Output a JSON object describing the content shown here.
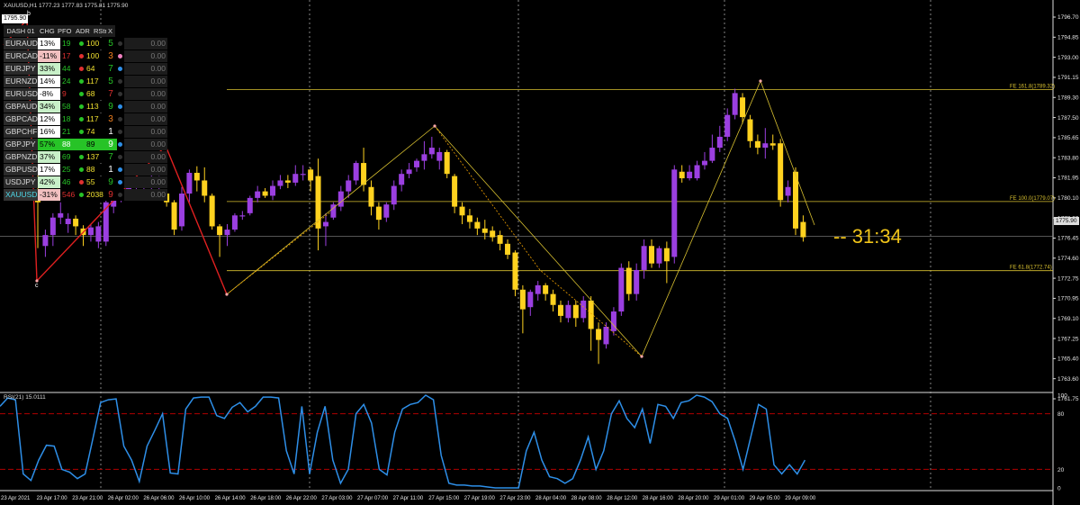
{
  "chart": {
    "title": "XAUUSD,H1  1777.23 1777.83 1775.81 1775.90",
    "price_box": "1795.90",
    "current_price": "1775.90",
    "timer": "-- 31:34",
    "rsi_label": "RSI(21) 15.0111",
    "point_labels": {
      "b": "b",
      "c": "c"
    }
  },
  "price_axis": [
    "1796.70",
    "1794.85",
    "1793.00",
    "1791.15",
    "1789.30",
    "1787.50",
    "1785.65",
    "1783.80",
    "1781.95",
    "1780.10",
    "1778.30",
    "1776.45",
    "1774.60",
    "1772.75",
    "1770.95",
    "1769.10",
    "1767.25",
    "1765.40",
    "1763.60",
    "1761.75"
  ],
  "rsi_axis": [
    "100",
    "80",
    "20",
    "0"
  ],
  "time_axis": [
    "23 Apr 2021",
    "23 Apr 17:00",
    "23 Apr 21:00",
    "26 Apr 02:00",
    "26 Apr 06:00",
    "26 Apr 10:00",
    "26 Apr 14:00",
    "26 Apr 18:00",
    "26 Apr 22:00",
    "27 Apr 03:00",
    "27 Apr 07:00",
    "27 Apr 11:00",
    "27 Apr 15:00",
    "27 Apr 19:00",
    "27 Apr 23:00",
    "28 Apr 04:00",
    "28 Apr 08:00",
    "28 Apr 12:00",
    "28 Apr 16:00",
    "28 Apr 20:00",
    "29 Apr 01:00",
    "29 Apr 05:00",
    "29 Apr 09:00"
  ],
  "fib_levels": [
    {
      "label": "FE 161.8(1789.32)",
      "price": 1789.32
    },
    {
      "label": "FE 100.0(1779.07)",
      "price": 1779.07
    },
    {
      "label": "FE 61.8(1772.74)",
      "price": 1772.74
    }
  ],
  "colors": {
    "bull": "#9b3fe0",
    "bear": "#ffd21f",
    "zigzag": "#e02020",
    "fib": "#d8c030",
    "rsi": "#2e8fe8",
    "rsi_level": "#b00000",
    "timer": "#f0c419"
  },
  "dashboard": {
    "title": "DASH 01",
    "headers": [
      "CHG",
      "PFO",
      "ADR",
      "RStr",
      "X"
    ],
    "rows": [
      {
        "sym": "EURAUD",
        "chg": "13%",
        "pfo": "19",
        "adr": "100",
        "rs": "5",
        "val": "0.00",
        "chg_bg": "#ffffff",
        "chg_fg": "#000",
        "pfo_bg": "#000",
        "pfo_fg": "#27c327",
        "dot": "#27c327",
        "adr_fg": "#f0e030",
        "rs_fg": "#27c327",
        "x": "#333",
        "sym_bg": "#2a2a2a",
        "sym_fg": "#ddd"
      },
      {
        "sym": "EURCAD",
        "chg": "-11%",
        "pfo": "17",
        "adr": "100",
        "rs": "3",
        "val": "0.00",
        "chg_bg": "#f2c0c0",
        "chg_fg": "#000",
        "pfo_bg": "#000",
        "pfo_fg": "#e03030",
        "dot": "#e03030",
        "adr_fg": "#f0e030",
        "rs_fg": "#f08020",
        "x": "#f080c0",
        "sym_bg": "#2a2a2a",
        "sym_fg": "#ddd"
      },
      {
        "sym": "EURJPY",
        "chg": "33%",
        "pfo": "44",
        "adr": "64",
        "rs": "7",
        "val": "0.00",
        "chg_bg": "#c8f0c8",
        "chg_fg": "#000",
        "pfo_bg": "#000",
        "pfo_fg": "#27c327",
        "dot": "#e03030",
        "adr_fg": "#f0e030",
        "rs_fg": "#27c327",
        "x": "#2e8fe8",
        "sym_bg": "#2a2a2a",
        "sym_fg": "#ddd"
      },
      {
        "sym": "EURNZD",
        "chg": "14%",
        "pfo": "24",
        "adr": "117",
        "rs": "5",
        "val": "0.00",
        "chg_bg": "#ffffff",
        "chg_fg": "#000",
        "pfo_bg": "#000",
        "pfo_fg": "#27c327",
        "dot": "#27c327",
        "adr_fg": "#f0e030",
        "rs_fg": "#27c327",
        "x": "#333",
        "sym_bg": "#2a2a2a",
        "sym_fg": "#ddd"
      },
      {
        "sym": "EURUSD",
        "chg": "-8%",
        "pfo": "9",
        "adr": "68",
        "rs": "7",
        "val": "0.00",
        "chg_bg": "#ffffff",
        "chg_fg": "#000",
        "pfo_bg": "#000",
        "pfo_fg": "#e03030",
        "dot": "#27c327",
        "adr_fg": "#f0e030",
        "rs_fg": "#e03030",
        "x": "#333",
        "sym_bg": "#2a2a2a",
        "sym_fg": "#ddd"
      },
      {
        "sym": "GBPAUD",
        "chg": "34%",
        "pfo": "58",
        "adr": "113",
        "rs": "9",
        "val": "0.00",
        "chg_bg": "#c8f0c8",
        "chg_fg": "#000",
        "pfo_bg": "#000",
        "pfo_fg": "#27c327",
        "dot": "#27c327",
        "adr_fg": "#f0e030",
        "rs_fg": "#27c327",
        "x": "#2e8fe8",
        "sym_bg": "#2a2a2a",
        "sym_fg": "#ddd"
      },
      {
        "sym": "GBPCAD",
        "chg": "12%",
        "pfo": "18",
        "adr": "117",
        "rs": "3",
        "val": "0.00",
        "chg_bg": "#ffffff",
        "chg_fg": "#000",
        "pfo_bg": "#000",
        "pfo_fg": "#27c327",
        "dot": "#27c327",
        "adr_fg": "#f0e030",
        "rs_fg": "#f08020",
        "x": "#333",
        "sym_bg": "#2a2a2a",
        "sym_fg": "#ddd"
      },
      {
        "sym": "GBPCHF",
        "chg": "16%",
        "pfo": "21",
        "adr": "74",
        "rs": "1",
        "val": "0.00",
        "chg_bg": "#ffffff",
        "chg_fg": "#000",
        "pfo_bg": "#000",
        "pfo_fg": "#27c327",
        "dot": "#27c327",
        "adr_fg": "#f0e030",
        "rs_fg": "#ffffff",
        "x": "#333",
        "sym_bg": "#2a2a2a",
        "sym_fg": "#ddd"
      },
      {
        "sym": "GBPJPY",
        "chg": "57%",
        "pfo": "88",
        "adr": "89",
        "rs": "9",
        "val": "0.00",
        "chg_bg": "#27c327",
        "chg_fg": "#000",
        "pfo_bg": "#27c327",
        "pfo_fg": "#fff",
        "dot": "#27c327",
        "adr_fg": "#000",
        "adr_bg": "#27c327",
        "rs_fg": "#ffffff",
        "rs_bg": "#27c327",
        "x": "#2e8fe8",
        "sym_bg": "#2a2a2a",
        "sym_fg": "#ddd"
      },
      {
        "sym": "GBPNZD",
        "chg": "37%",
        "pfo": "69",
        "adr": "137",
        "rs": "7",
        "val": "0.00",
        "chg_bg": "#c8f0c8",
        "chg_fg": "#000",
        "pfo_bg": "#000",
        "pfo_fg": "#27c327",
        "dot": "#27c327",
        "adr_fg": "#f0e030",
        "rs_fg": "#27c327",
        "x": "#333",
        "sym_bg": "#2a2a2a",
        "sym_fg": "#ddd"
      },
      {
        "sym": "GBPUSD",
        "chg": "17%",
        "pfo": "25",
        "adr": "88",
        "rs": "1",
        "val": "0.00",
        "chg_bg": "#ffffff",
        "chg_fg": "#000",
        "pfo_bg": "#000",
        "pfo_fg": "#27c327",
        "dot": "#27c327",
        "adr_fg": "#f0e030",
        "rs_fg": "#ffffff",
        "x": "#2e8fe8",
        "sym_bg": "#2a2a2a",
        "sym_fg": "#ddd"
      },
      {
        "sym": "USDJPY",
        "chg": "42%",
        "pfo": "46",
        "adr": "55",
        "rs": "9",
        "val": "0.00",
        "chg_bg": "#c8f0c8",
        "chg_fg": "#000",
        "pfo_bg": "#000",
        "pfo_fg": "#27c327",
        "dot": "#e03030",
        "adr_fg": "#f0e030",
        "rs_fg": "#27c327",
        "x": "#2e8fe8",
        "sym_bg": "#2a2a2a",
        "sym_fg": "#ddd"
      },
      {
        "sym": "XAUUSD",
        "chg": "-31%",
        "pfo": "546",
        "adr": "2038",
        "rs": "9",
        "val": "0.00",
        "chg_bg": "#f2c0c0",
        "chg_fg": "#000",
        "pfo_bg": "#000",
        "pfo_fg": "#e03030",
        "dot": "#27c327",
        "adr_fg": "#f0e030",
        "rs_fg": "#e03030",
        "x": "#333",
        "sym_bg": "#333",
        "sym_fg": "#4fd8e8"
      }
    ]
  }
}
